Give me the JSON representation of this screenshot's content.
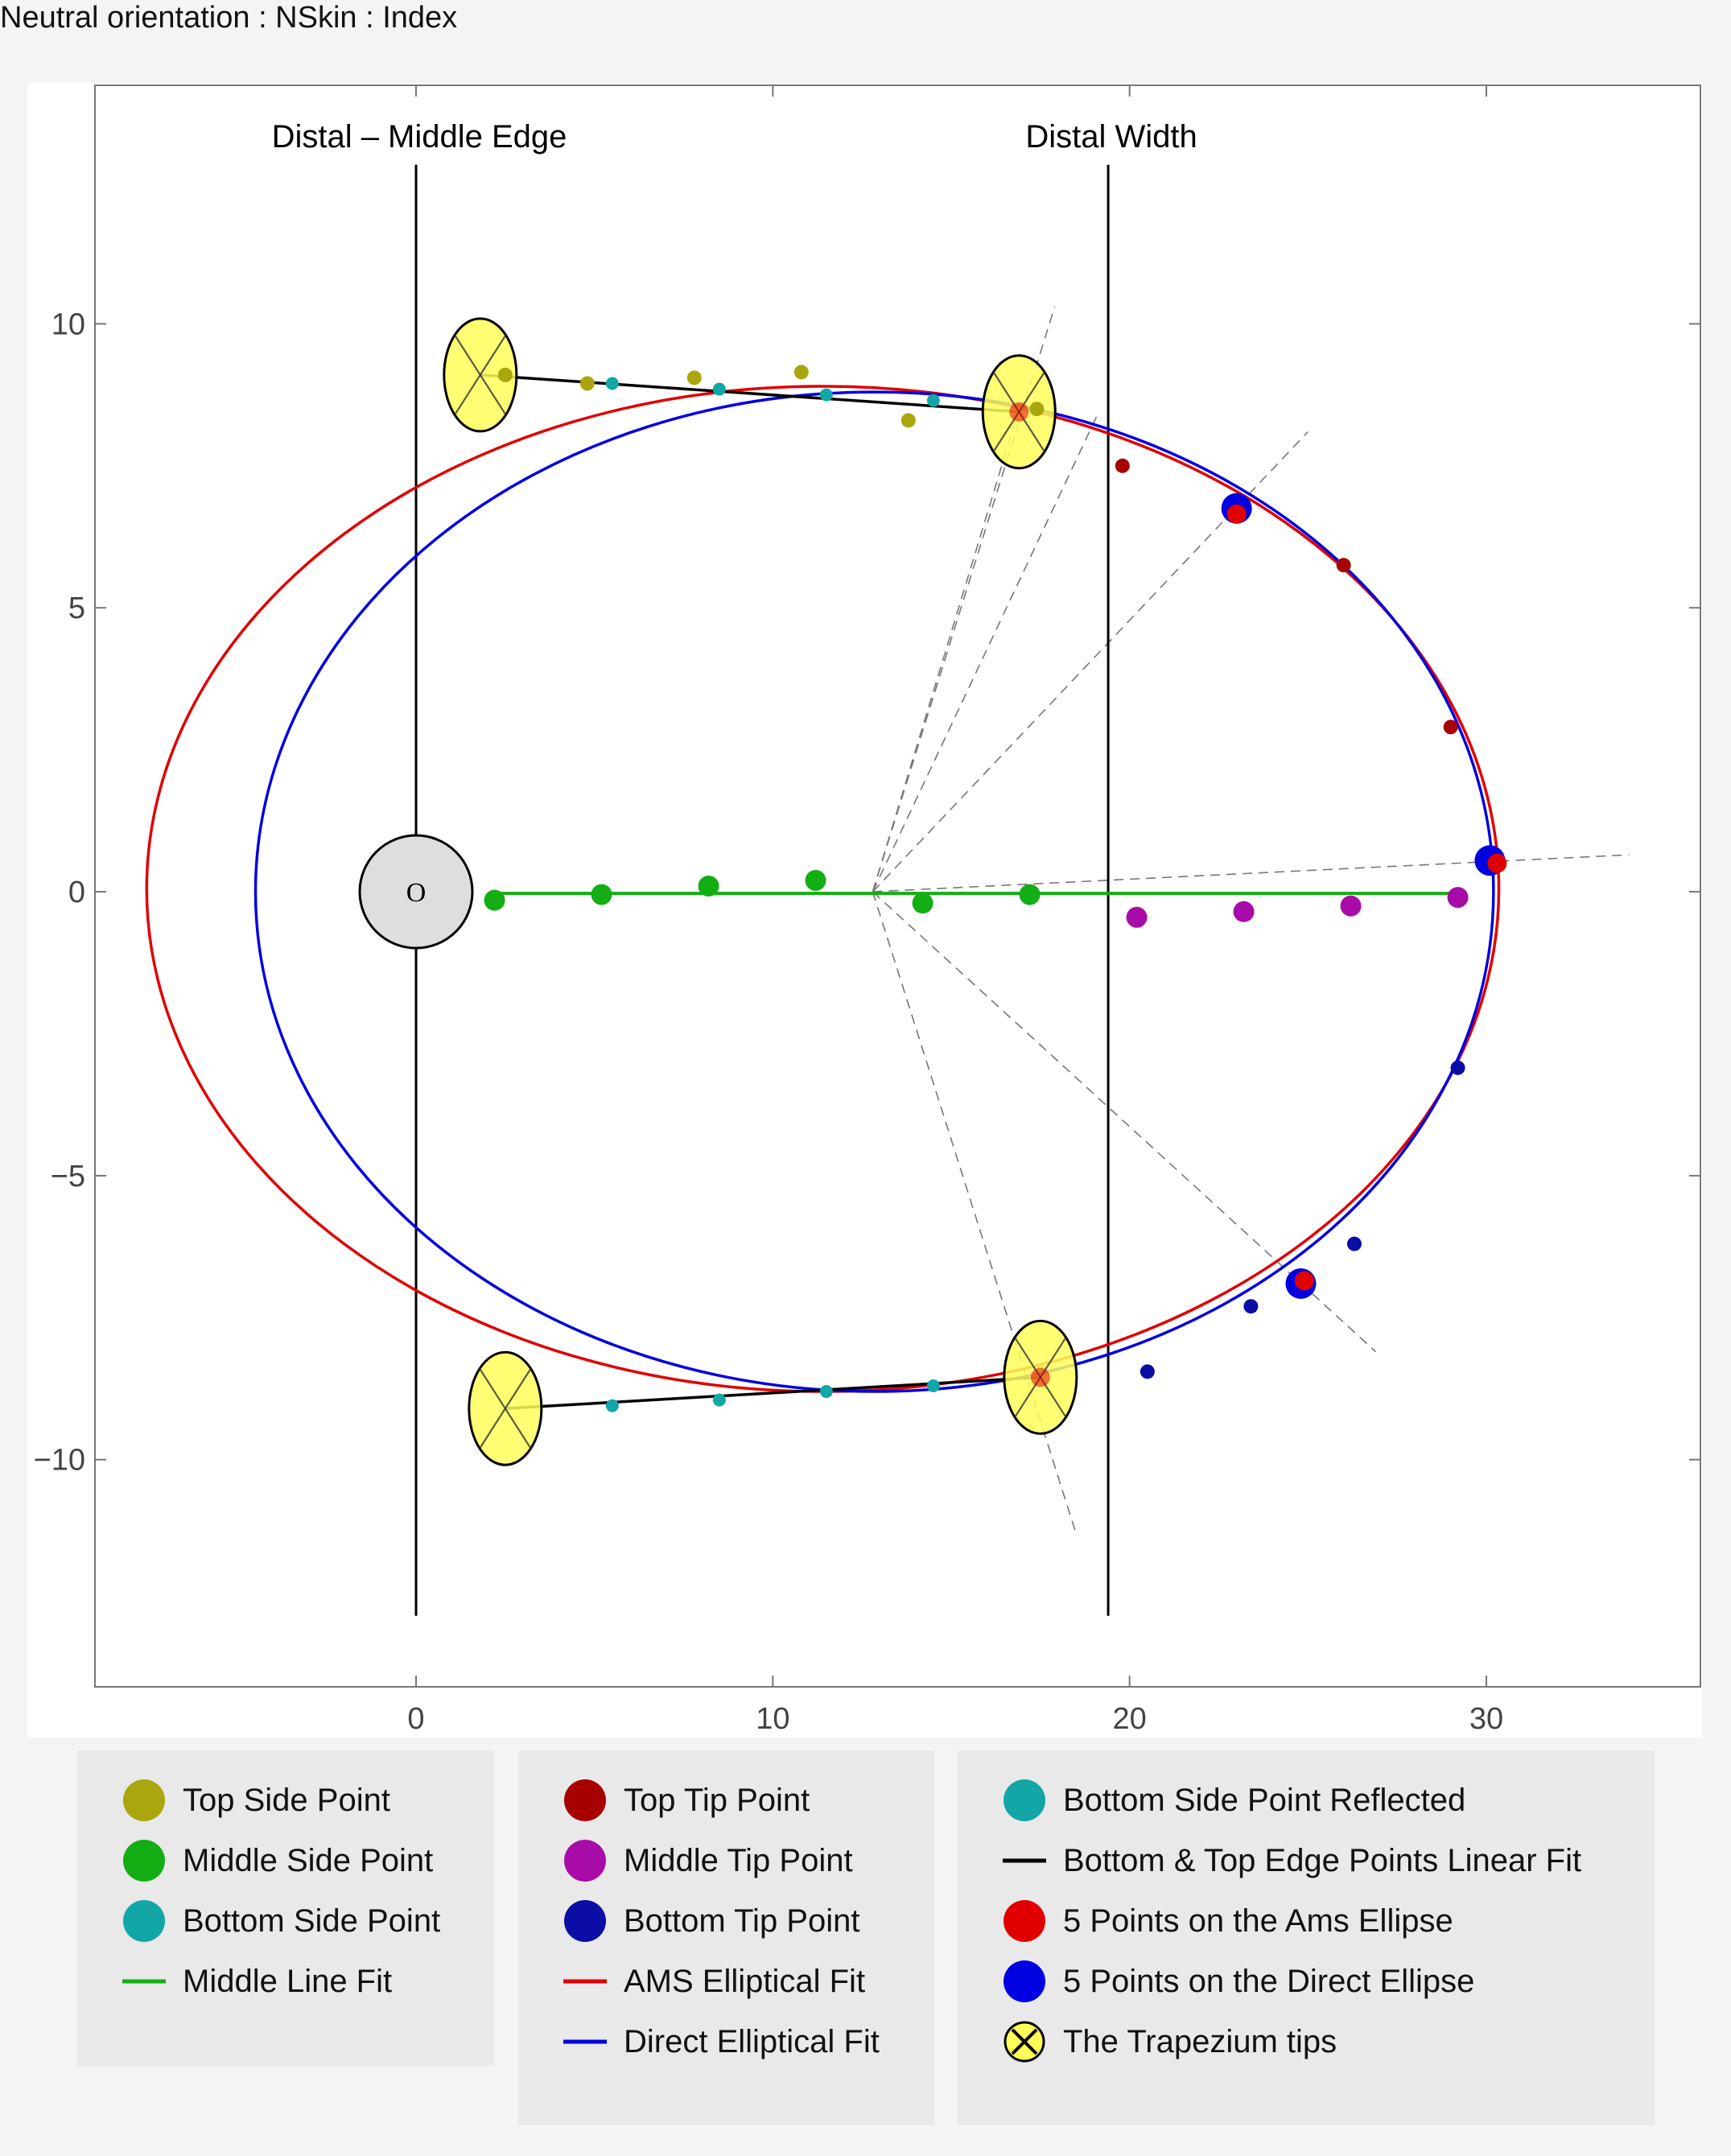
{
  "page_title": "Neutral orientation : NSkin : Index",
  "colors": {
    "top_side": "#aaa60d",
    "middle_side": "#13ae13",
    "bottom_side": "#13a6a6",
    "top_tip": "#a80000",
    "middle_tip": "#a80ca8",
    "bottom_tip": "#0c0ca6",
    "ams_fit": "#e00000",
    "direct_fit": "#0000e0",
    "linear_fit": "#000000",
    "trapezium_fill": "#ffff5a"
  },
  "chart_data": {
    "type": "scatter",
    "title": "",
    "xlabel": "",
    "ylabel": "",
    "xlim": [
      -9,
      36
    ],
    "ylim": [
      -14,
      14.2
    ],
    "x_ticks": [
      0,
      10,
      20,
      30
    ],
    "y_ticks": [
      10,
      5,
      0,
      -5,
      -10
    ],
    "x_tick_labels": [
      "0",
      "10",
      "20",
      "30"
    ],
    "y_tick_labels": [
      "10",
      "5",
      "0",
      "−5",
      "−10"
    ],
    "grid": false,
    "legend_position": "bottom",
    "vertical_lines": [
      {
        "x": 0,
        "label": "Distal – Middle Edge"
      },
      {
        "x": 19.4,
        "label": "Distal Width"
      }
    ],
    "origin_marker": {
      "x": 0,
      "y": 0,
      "label": "O"
    },
    "series": [
      {
        "name": "Top Side Point",
        "color_key": "top_side",
        "points": [
          [
            2.5,
            9.1
          ],
          [
            4.8,
            8.95
          ],
          [
            7.8,
            9.05
          ],
          [
            10.8,
            9.15
          ],
          [
            13.8,
            8.3
          ],
          [
            17.4,
            8.5
          ]
        ]
      },
      {
        "name": "Middle Side Point",
        "color_key": "middle_side",
        "points": [
          [
            2.2,
            -0.15
          ],
          [
            5.2,
            -0.05
          ],
          [
            8.2,
            0.1
          ],
          [
            11.2,
            0.2
          ],
          [
            14.2,
            -0.2
          ],
          [
            17.2,
            -0.05
          ]
        ]
      },
      {
        "name": "Bottom Side Point",
        "color_key": "bottom_side",
        "points": [
          [
            5.5,
            -9.05
          ],
          [
            8.5,
            -8.95
          ],
          [
            11.5,
            -8.8
          ],
          [
            14.5,
            -8.7
          ]
        ]
      },
      {
        "name": "Bottom Side Point Reflected",
        "color_key": "bottom_side",
        "points": [
          [
            5.5,
            8.95
          ],
          [
            8.5,
            8.85
          ],
          [
            11.5,
            8.75
          ],
          [
            14.5,
            8.65
          ]
        ]
      },
      {
        "name": "Top Tip Point",
        "color_key": "top_tip",
        "points": [
          [
            19.8,
            7.5
          ],
          [
            26.0,
            5.75
          ],
          [
            29.0,
            2.9
          ]
        ]
      },
      {
        "name": "Middle Tip Point",
        "color_key": "middle_tip",
        "points": [
          [
            20.2,
            -0.45
          ],
          [
            23.2,
            -0.35
          ],
          [
            26.2,
            -0.25
          ],
          [
            29.2,
            -0.1
          ]
        ]
      },
      {
        "name": "Bottom Tip Point",
        "color_key": "bottom_tip",
        "points": [
          [
            29.2,
            -3.1
          ],
          [
            26.3,
            -6.2
          ],
          [
            23.4,
            -7.3
          ],
          [
            20.5,
            -8.45
          ]
        ]
      },
      {
        "name": "5 Points on the Ams Ellipse",
        "color_key": "ams_fit",
        "points": [
          [
            30.3,
            0.5
          ],
          [
            23.0,
            6.65
          ],
          [
            24.9,
            -6.85
          ],
          [
            16.9,
            8.45
          ],
          [
            17.5,
            -8.55
          ]
        ]
      },
      {
        "name": "5 Points on the Direct Ellipse",
        "color_key": "direct_fit",
        "points": [
          [
            30.1,
            0.55
          ],
          [
            23.0,
            6.75
          ],
          [
            24.8,
            -6.9
          ]
        ]
      }
    ],
    "fits": [
      {
        "name": "Middle Line Fit",
        "color_key": "middle_side",
        "x": [
          2.2,
          29.2
        ],
        "y": [
          -0.03,
          -0.03
        ]
      },
      {
        "name": "Bottom & Top Edge Points Linear Fit",
        "color_key": "linear_fit",
        "segments": [
          [
            [
              1.8,
              9.1
            ],
            [
              16.9,
              8.45
            ]
          ],
          [
            [
              2.5,
              -9.1
            ],
            [
              17.5,
              -8.55
            ]
          ]
        ]
      },
      {
        "name": "AMS Elliptical Fit",
        "color_key": "ams_fit",
        "ellipse": {
          "cx": 11.4,
          "cy": 0.05,
          "rx": 18.95,
          "ry": 8.85
        }
      },
      {
        "name": "Direct Elliptical Fit",
        "color_key": "direct_fit",
        "ellipse": {
          "cx": 12.85,
          "cy": 0.0,
          "rx": 17.35,
          "ry": 8.8
        }
      }
    ],
    "trapezium_tips": [
      [
        1.8,
        9.1
      ],
      [
        16.9,
        8.45
      ],
      [
        2.5,
        -9.1
      ],
      [
        17.5,
        -8.55
      ]
    ],
    "construction_lines": {
      "center": [
        12.8,
        0.0
      ],
      "ends": [
        [
          17.9,
          10.3
        ],
        [
          25.0,
          8.1
        ],
        [
          34.0,
          0.65
        ],
        [
          26.9,
          -8.1
        ],
        [
          18.5,
          -11.3
        ],
        [
          16.8,
          8.3
        ],
        [
          19.1,
          8.4
        ]
      ]
    }
  },
  "legend": [
    [
      {
        "label": "Top Side Point",
        "kind": "dot",
        "color_key": "top_side"
      },
      {
        "label": "Middle Side Point",
        "kind": "dot",
        "color_key": "middle_side"
      },
      {
        "label": "Bottom Side Point",
        "kind": "dot",
        "color_key": "bottom_side"
      },
      {
        "label": "Middle Line Fit",
        "kind": "line",
        "color_key": "middle_side"
      }
    ],
    [
      {
        "label": "Top Tip Point",
        "kind": "dot",
        "color_key": "top_tip"
      },
      {
        "label": "Middle Tip Point",
        "kind": "dot",
        "color_key": "middle_tip"
      },
      {
        "label": "Bottom Tip Point",
        "kind": "dot",
        "color_key": "bottom_tip"
      },
      {
        "label": "AMS Elliptical Fit",
        "kind": "line",
        "color_key": "ams_fit"
      },
      {
        "label": "Direct Elliptical Fit",
        "kind": "line",
        "color_key": "direct_fit"
      }
    ],
    [
      {
        "label": "Bottom Side Point Reflected",
        "kind": "dot",
        "color_key": "bottom_side"
      },
      {
        "label": "Bottom & Top Edge Points Linear Fit",
        "kind": "line",
        "color_key": "linear_fit"
      },
      {
        "label": "5 Points on the Ams Ellipse",
        "kind": "dot",
        "color_key": "ams_fit"
      },
      {
        "label": "5 Points on the Direct Ellipse",
        "kind": "dot",
        "color_key": "direct_fit"
      },
      {
        "label": "The Trapezium tips",
        "kind": "trapezium",
        "color_key": "trapezium_fill"
      }
    ]
  ]
}
